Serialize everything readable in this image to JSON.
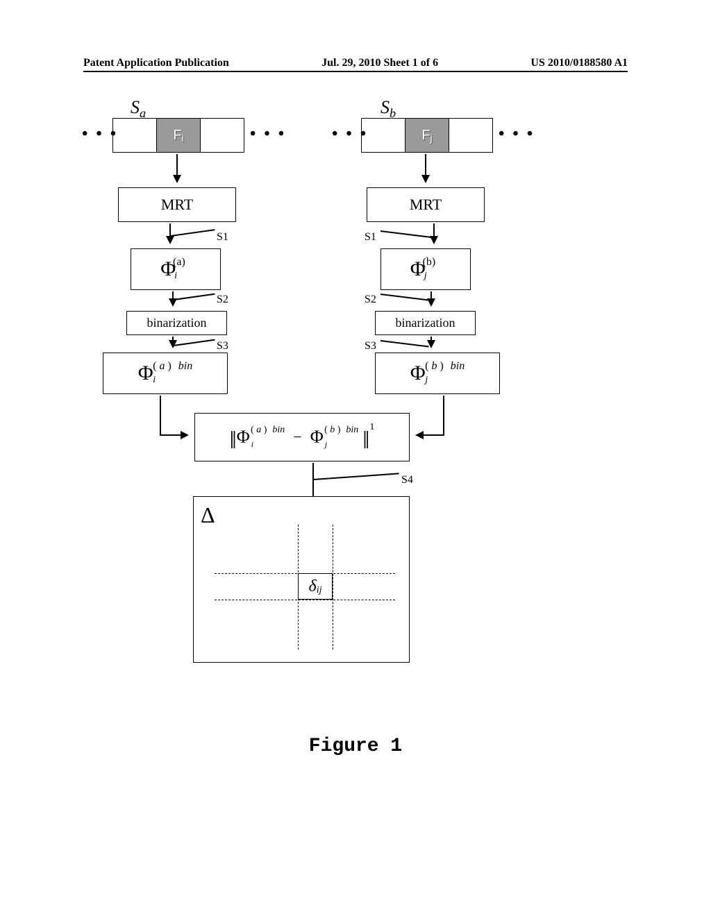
{
  "header": {
    "left": "Patent Application Publication",
    "center": "Jul. 29, 2010  Sheet 1 of 6",
    "right": "US 2010/0188580 A1"
  },
  "sequence_labels": {
    "a": "S",
    "a_sub": "a",
    "b": "S",
    "b_sub": "b"
  },
  "frame_labels": {
    "a": "F",
    "a_sub": "i",
    "b": "F",
    "b_sub": "j"
  },
  "blocks": {
    "mrt": "MRT",
    "binarization": "binarization"
  },
  "phi": {
    "symbol": "Φ",
    "a_sup": "(a)",
    "a_sub": "i",
    "b_sup": "(b)",
    "b_sub": "j",
    "bin": "bin"
  },
  "norm": {
    "minus": "−",
    "exp": "1"
  },
  "steps": {
    "s1": "S1",
    "s2": "S2",
    "s3": "S3",
    "s4": "S4"
  },
  "matrix": {
    "delta_upper": "Δ",
    "delta_lower": "δ",
    "delta_sub": "ij"
  },
  "caption": "Figure 1",
  "dots": "• • •"
}
